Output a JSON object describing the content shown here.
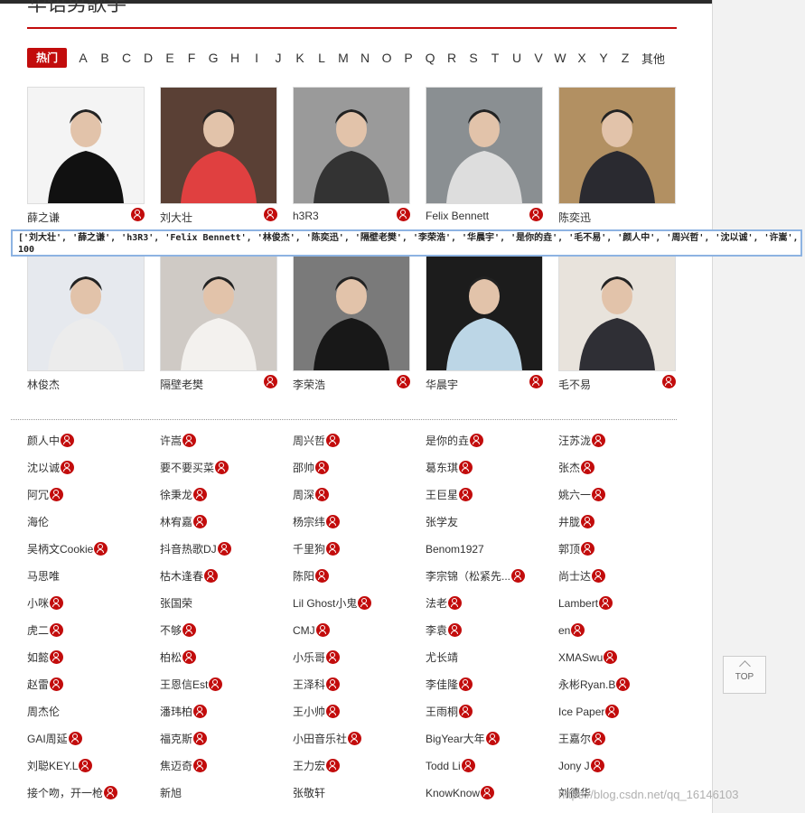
{
  "page": {
    "title": "华语男歌手"
  },
  "alphabet": {
    "hot_label": "热门",
    "letters": [
      "A",
      "B",
      "C",
      "D",
      "E",
      "F",
      "G",
      "H",
      "I",
      "J",
      "K",
      "L",
      "M",
      "N",
      "O",
      "P",
      "Q",
      "R",
      "S",
      "T",
      "U",
      "V",
      "W",
      "X",
      "Y",
      "Z"
    ],
    "other_label": "其他"
  },
  "featured": [
    {
      "name": "薛之谦",
      "badge": true,
      "photo": "person-portrait-black-suit"
    },
    {
      "name": "刘大壮",
      "badge": true,
      "photo": "person-red-hoodie-on-stage"
    },
    {
      "name": "h3R3",
      "badge": true,
      "photo": "people-sitting-monochrome"
    },
    {
      "name": "Felix Bennett",
      "badge": true,
      "photo": "person-at-airport"
    },
    {
      "name": "陈奕迅",
      "badge": false,
      "photo": "person-dark-jacket-portrait"
    },
    {
      "name": "林俊杰",
      "badge": false,
      "photo": "person-white-shirt-portrait"
    },
    {
      "name": "隔壁老樊",
      "badge": true,
      "photo": "person-white-sweater"
    },
    {
      "name": "李荣浩",
      "badge": true,
      "photo": "person-leather-jacket"
    },
    {
      "name": "华晨宇",
      "badge": true,
      "photo": "person-denim-jacket-dark"
    },
    {
      "name": "毛不易",
      "badge": true,
      "photo": "person-sitting-chair-studio"
    }
  ],
  "overlay": {
    "line1": "['刘大壮', '薛之谦', 'h3R3', 'Felix Bennett', '林俊杰', '陈奕迅', '隔壁老樊', '李荣浩', '华晨宇', '是你的垚', '毛不易', '颜人中', '周兴哲', '沈以诚', '许嵩', '汪苏",
    "line2": "100"
  },
  "artist_list": [
    [
      {
        "name": "颜人中",
        "badge": true
      },
      {
        "name": "许嵩",
        "badge": true
      },
      {
        "name": "周兴哲",
        "badge": true
      },
      {
        "name": "是你的垚",
        "badge": true
      },
      {
        "name": "汪苏泷",
        "badge": true
      }
    ],
    [
      {
        "name": "沈以诚",
        "badge": true
      },
      {
        "name": "要不要买菜",
        "badge": true
      },
      {
        "name": "邵帅",
        "badge": true
      },
      {
        "name": "葛东琪",
        "badge": true
      },
      {
        "name": "张杰",
        "badge": true
      }
    ],
    [
      {
        "name": "阿冗",
        "badge": true
      },
      {
        "name": "徐秉龙",
        "badge": true
      },
      {
        "name": "周深",
        "badge": true
      },
      {
        "name": "王巨星",
        "badge": true
      },
      {
        "name": "姚六一",
        "badge": true
      }
    ],
    [
      {
        "name": "海伦",
        "badge": false
      },
      {
        "name": "林宥嘉",
        "badge": true
      },
      {
        "name": "杨宗纬",
        "badge": true
      },
      {
        "name": "张学友",
        "badge": false
      },
      {
        "name": "井胧",
        "badge": true
      }
    ],
    [
      {
        "name": "吴柄文Cookie",
        "badge": true
      },
      {
        "name": "抖音热歌DJ",
        "badge": true
      },
      {
        "name": "千里狗",
        "badge": true
      },
      {
        "name": "Benom1927",
        "badge": false
      },
      {
        "name": "郭顶",
        "badge": true
      }
    ],
    [
      {
        "name": "马思唯",
        "badge": false
      },
      {
        "name": "枯木逢春",
        "badge": true
      },
      {
        "name": "陈阳",
        "badge": true
      },
      {
        "name": "李宗锦（松紧先...",
        "badge": true
      },
      {
        "name": "尚士达",
        "badge": true
      }
    ],
    [
      {
        "name": "小咪",
        "badge": true
      },
      {
        "name": "张国荣",
        "badge": false
      },
      {
        "name": "Lil Ghost小鬼",
        "badge": true
      },
      {
        "name": "法老",
        "badge": true
      },
      {
        "name": "Lambert",
        "badge": true
      }
    ],
    [
      {
        "name": "虎二",
        "badge": true
      },
      {
        "name": "不够",
        "badge": true
      },
      {
        "name": "CMJ",
        "badge": true
      },
      {
        "name": "李袁",
        "badge": true
      },
      {
        "name": "en",
        "badge": true
      }
    ],
    [
      {
        "name": "如懿",
        "badge": true
      },
      {
        "name": "柏松",
        "badge": true
      },
      {
        "name": "小乐哥",
        "badge": true
      },
      {
        "name": "尤长靖",
        "badge": false
      },
      {
        "name": "XMASwu",
        "badge": true
      }
    ],
    [
      {
        "name": "赵雷",
        "badge": true
      },
      {
        "name": "王恩信Est",
        "badge": true
      },
      {
        "name": "王泽科",
        "badge": true
      },
      {
        "name": "李佳隆",
        "badge": true
      },
      {
        "name": "永彬Ryan.B",
        "badge": true
      }
    ],
    [
      {
        "name": "周杰伦",
        "badge": false
      },
      {
        "name": "潘玮柏",
        "badge": true
      },
      {
        "name": "王小帅",
        "badge": true
      },
      {
        "name": "王雨桐",
        "badge": true
      },
      {
        "name": "Ice Paper",
        "badge": true
      }
    ],
    [
      {
        "name": "GAI周延",
        "badge": true
      },
      {
        "name": "福克斯",
        "badge": true
      },
      {
        "name": "小田音乐社",
        "badge": true
      },
      {
        "name": "BigYear大年",
        "badge": true
      },
      {
        "name": "王嘉尔",
        "badge": true
      }
    ],
    [
      {
        "name": "刘聪KEY.L",
        "badge": true
      },
      {
        "name": "焦迈奇",
        "badge": true
      },
      {
        "name": "王力宏",
        "badge": true
      },
      {
        "name": "Todd Li",
        "badge": true
      },
      {
        "name": "Jony J",
        "badge": true
      }
    ],
    [
      {
        "name": "接个吻，开一枪",
        "badge": true
      },
      {
        "name": "新旭",
        "badge": false
      },
      {
        "name": "张敬轩",
        "badge": false
      },
      {
        "name": "KnowKnow",
        "badge": true
      },
      {
        "name": "刘德华",
        "badge": false
      }
    ]
  ],
  "top_button": {
    "label": "TOP"
  },
  "watermark": "https://blog.csdn.net/qq_16146103",
  "colors": {
    "accent": "#c20c0c",
    "text": "#333333",
    "overlay_border": "#8db3e2"
  }
}
